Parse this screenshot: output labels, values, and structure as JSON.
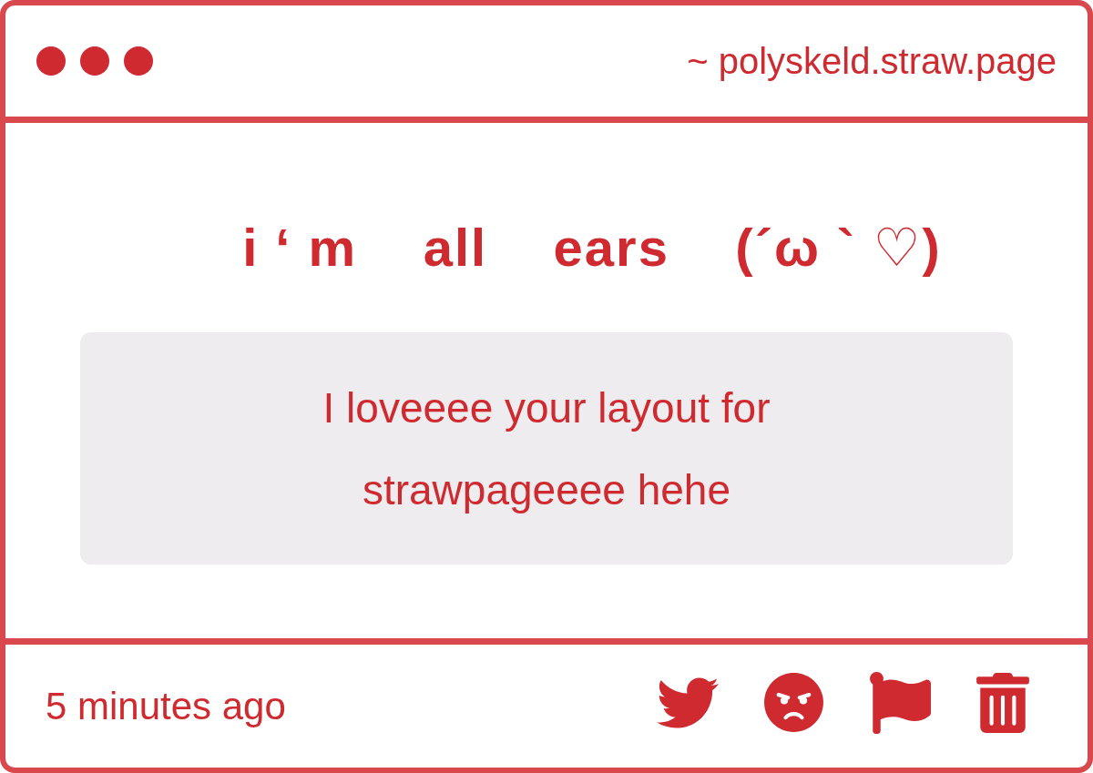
{
  "window": {
    "url": "~ polyskeld.straw.page"
  },
  "title": "i ‘ m    all    ears    (´ω ` ♡)",
  "message": {
    "text": "I loveeee your layout for strawpageeee hehe"
  },
  "footer": {
    "time": "5 minutes ago"
  }
}
